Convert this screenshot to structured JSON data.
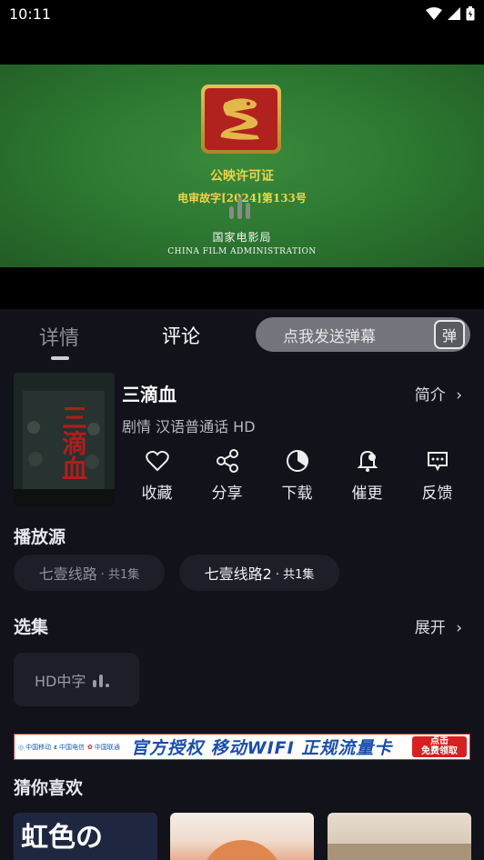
{
  "status_bar": {
    "time": "10:11"
  },
  "player": {
    "license_title": "公映许可证",
    "license_number": "电审故字[2024]第133号",
    "administration_cn": "国家电影局",
    "administration_en": "CHINA FILM ADMINISTRATION"
  },
  "tabs": {
    "details": "详情",
    "comments": "评论"
  },
  "danmaku": {
    "placeholder": "点我发送弹幕",
    "icon_label": "弹"
  },
  "movie": {
    "poster_title": "三滴血",
    "title": "三滴血",
    "meta": "剧情 汉语普通话 HD",
    "synopsis_label": "简介"
  },
  "actions": [
    {
      "label": "收藏",
      "icon": "heart-icon"
    },
    {
      "label": "分享",
      "icon": "share-icon"
    },
    {
      "label": "下载",
      "icon": "download-icon"
    },
    {
      "label": "催更",
      "icon": "bell-icon"
    },
    {
      "label": "反馈",
      "icon": "feedback-icon"
    }
  ],
  "sources": {
    "title": "播放源",
    "items": [
      {
        "name": "七壹线路",
        "count": "· 共1集"
      },
      {
        "name": "七壹线路2",
        "count": "· 共1集"
      }
    ]
  },
  "episodes": {
    "title": "选集",
    "expand_label": "展开",
    "items": [
      "HD中字"
    ]
  },
  "banner": {
    "operators": [
      "中国移动",
      "中国电信",
      "中国联通"
    ],
    "text": "官方授权 移动WIFI 正规流量卡",
    "cta_line1": "点击",
    "cta_line2": "免费领取"
  },
  "recommendations": {
    "title": "猜你喜欢",
    "items": [
      {
        "poster_text": "虹色の"
      },
      {
        "poster_text": ""
      },
      {
        "poster_text": ""
      }
    ]
  },
  "colors": {
    "background": "#12121a",
    "license_gold": "#f0d24a",
    "player_green": "#2e7a32",
    "banner_blue": "#1a4db0",
    "banner_red": "#d72020"
  }
}
